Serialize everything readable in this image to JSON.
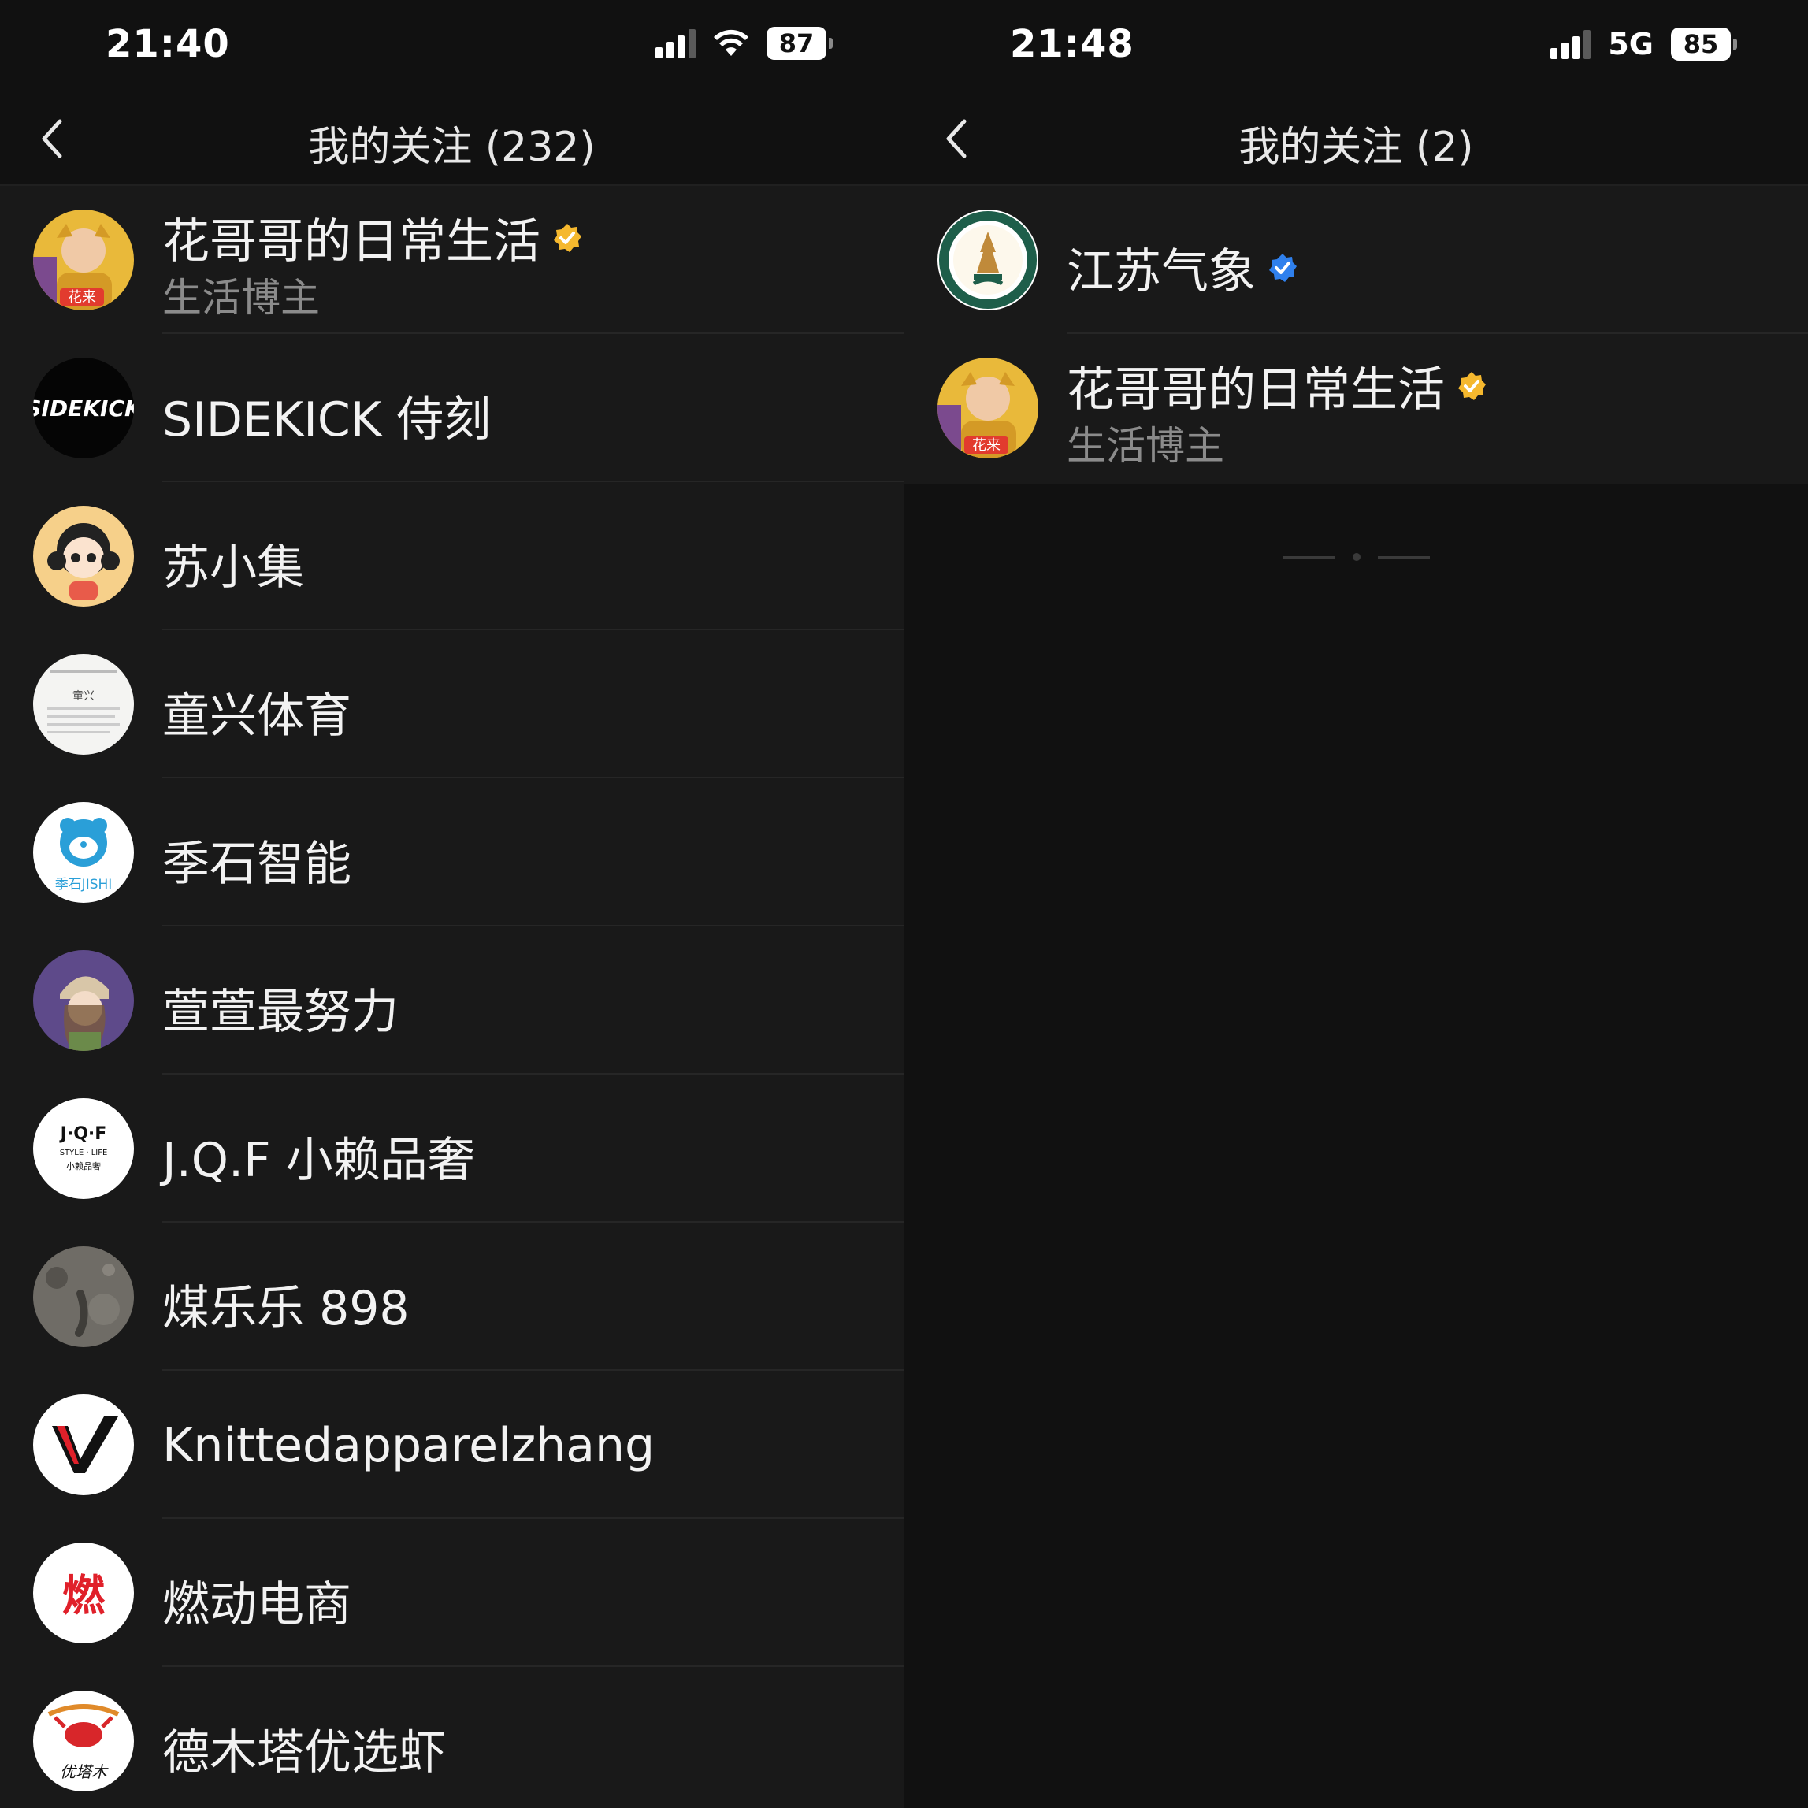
{
  "left": {
    "status": {
      "time": "21:40",
      "battery": "87"
    },
    "title": "我的关注 (232)",
    "follows": [
      {
        "name": "花哥哥的日常生活",
        "subtitle": "生活博主",
        "badge": "gold-verified-icon",
        "avatar": "huagege-avatar",
        "avatar_text": "花来"
      },
      {
        "name": "SIDEKICK 侍刻",
        "avatar": "sidekick-avatar",
        "avatar_text": "SIDEKICK"
      },
      {
        "name": "苏小集",
        "avatar": "suxiaoji-avatar"
      },
      {
        "name": "童兴体育",
        "avatar": "tongxing-avatar",
        "avatar_text": "童兴"
      },
      {
        "name": "季石智能",
        "avatar": "jishi-avatar",
        "avatar_text": "季石JISHI"
      },
      {
        "name": "萱萱最努力",
        "avatar": "xuanxuan-avatar"
      },
      {
        "name": "J.Q.F 小赖品奢",
        "avatar": "jqf-avatar",
        "avatar_text": "J·Q·F",
        "avatar_text2": "STYLE · LIFE",
        "avatar_text3": "小赖品奢"
      },
      {
        "name": "煤乐乐 898",
        "avatar": "meilele-avatar"
      },
      {
        "name": "Knittedapparelzhang",
        "avatar": "knitted-avatar"
      },
      {
        "name": "燃动电商",
        "avatar": "randong-avatar",
        "avatar_text": "燃"
      },
      {
        "name": "德木塔优选虾",
        "avatar": "demuta-avatar",
        "avatar_text": "优塔木"
      }
    ]
  },
  "right": {
    "status": {
      "time": "21:48",
      "network": "5G",
      "battery": "85"
    },
    "title": "我的关注 (2)",
    "follows": [
      {
        "name": "江苏气象",
        "badge": "blue-verified-icon",
        "avatar": "jiangsu-weather-avatar"
      },
      {
        "name": "花哥哥的日常生活",
        "subtitle": "生活博主",
        "badge": "gold-verified-icon",
        "avatar": "huagege-avatar",
        "avatar_text": "花来"
      }
    ]
  },
  "colors": {
    "background": "#191919",
    "bar": "#111111",
    "gold_badge": "#f5b82e",
    "blue_badge": "#2f80ed",
    "subtitle": "#8b8b8b"
  }
}
